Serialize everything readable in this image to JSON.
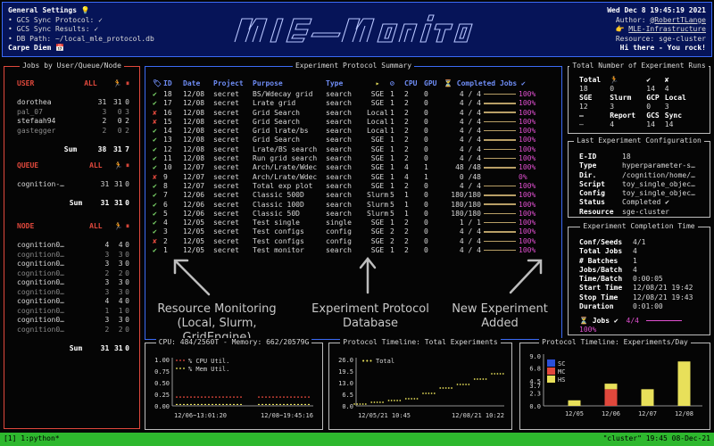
{
  "header": {
    "title": "General Settings",
    "title_icon": "lightbulb-icon",
    "lines": [
      "• GCS Sync Protocol: ✓",
      "• GCS Sync Results: ✓",
      "• DB Path: ~/local_mle_protocol.db"
    ],
    "motto": "Carpe Diem",
    "motto_icon": "calendar-icon",
    "date": "Wed Dec 8 19:45:19 2021",
    "author_label": "Author:",
    "author": "@RobertTLange",
    "infra": "MLE-Infrastructure",
    "resource": "Resource: sge-cluster",
    "greeting": "Hi there - You rock!",
    "logo_text": "mle-monitor"
  },
  "jobs_panel": {
    "title": "Jobs by User/Queue/Node",
    "user_section": {
      "header": [
        "USER",
        "ALL",
        "🏃",
        "⏸"
      ],
      "rows": [
        [
          "dorothea",
          "31",
          "31",
          "0"
        ],
        [
          "pal_07",
          "3",
          "0",
          "3"
        ],
        [
          "stefaah94",
          "2",
          "0",
          "2"
        ],
        [
          "gastegger",
          "2",
          "0",
          "2"
        ]
      ],
      "sum": [
        "Sum",
        "38",
        "31",
        "7"
      ]
    },
    "queue_section": {
      "header": [
        "QUEUE",
        "ALL",
        "🏃",
        "⏸"
      ],
      "rows": [
        [
          "cognition-…",
          "31",
          "31",
          "0"
        ]
      ],
      "sum": [
        "Sum",
        "31",
        "31",
        "0"
      ]
    },
    "node_section": {
      "header": [
        "NODE",
        "ALL",
        "🏃",
        "⏸"
      ],
      "rows": [
        [
          "cognition0…",
          "4",
          "4",
          "0"
        ],
        [
          "cognition0…",
          "3",
          "3",
          "0"
        ],
        [
          "cognition0…",
          "3",
          "3",
          "0"
        ],
        [
          "cognition0…",
          "2",
          "2",
          "0"
        ],
        [
          "cognition0…",
          "3",
          "3",
          "0"
        ],
        [
          "cognition0…",
          "3",
          "3",
          "0"
        ],
        [
          "cognition0…",
          "4",
          "4",
          "0"
        ],
        [
          "cognition0…",
          "1",
          "1",
          "0"
        ],
        [
          "cognition0…",
          "3",
          "3",
          "0"
        ],
        [
          "cognition0…",
          "2",
          "2",
          "0"
        ]
      ],
      "sum": [
        "Sum",
        "31",
        "31",
        "0"
      ]
    }
  },
  "protocol": {
    "title": "Experiment Protocol Summary",
    "columns": [
      "",
      "ID",
      "Date",
      "Project",
      "Purpose",
      "Type",
      "▸",
      "⊘",
      "CPU",
      "GPU",
      "⏳ Completed Jobs ✔"
    ],
    "rows": [
      {
        "status": "✔",
        "id": "18",
        "date": "12/08",
        "project": "secret",
        "purpose": "BS/Wdecay grid",
        "type": "search",
        "res": "SGE",
        "a": "1",
        "cpu": "2",
        "gpu": "0",
        "done": "4 / 4",
        "pct": "100%",
        "frac": 1.0
      },
      {
        "status": "✔",
        "id": "17",
        "date": "12/08",
        "project": "secret",
        "purpose": "Lrate grid",
        "type": "search",
        "res": "SGE",
        "a": "1",
        "cpu": "2",
        "gpu": "0",
        "done": "4 / 4",
        "pct": "100%",
        "frac": 1.0
      },
      {
        "status": "✘",
        "id": "16",
        "date": "12/08",
        "project": "secret",
        "purpose": "Grid Search",
        "type": "search",
        "res": "Local",
        "a": "1",
        "cpu": "2",
        "gpu": "0",
        "done": "4 / 4",
        "pct": "100%",
        "frac": 1.0
      },
      {
        "status": "✘",
        "id": "15",
        "date": "12/08",
        "project": "secret",
        "purpose": "Grid Search",
        "type": "search",
        "res": "Local",
        "a": "1",
        "cpu": "2",
        "gpu": "0",
        "done": "4 / 4",
        "pct": "100%",
        "frac": 1.0
      },
      {
        "status": "✔",
        "id": "14",
        "date": "12/08",
        "project": "secret",
        "purpose": "Grid lrate/bs",
        "type": "search",
        "res": "Local",
        "a": "1",
        "cpu": "2",
        "gpu": "0",
        "done": "4 / 4",
        "pct": "100%",
        "frac": 1.0
      },
      {
        "status": "✔",
        "id": "13",
        "date": "12/08",
        "project": "secret",
        "purpose": "Grid Search",
        "type": "search",
        "res": "SGE",
        "a": "1",
        "cpu": "2",
        "gpu": "0",
        "done": "4 / 4",
        "pct": "100%",
        "frac": 1.0
      },
      {
        "status": "✔",
        "id": "12",
        "date": "12/08",
        "project": "secret",
        "purpose": "Lrate/BS search",
        "type": "search",
        "res": "SGE",
        "a": "1",
        "cpu": "2",
        "gpu": "0",
        "done": "4 / 4",
        "pct": "100%",
        "frac": 1.0
      },
      {
        "status": "✔",
        "id": "11",
        "date": "12/08",
        "project": "secret",
        "purpose": "Run grid search",
        "type": "search",
        "res": "SGE",
        "a": "1",
        "cpu": "2",
        "gpu": "0",
        "done": "4 / 4",
        "pct": "100%",
        "frac": 1.0
      },
      {
        "status": "✔",
        "id": "10",
        "date": "12/07",
        "project": "secret",
        "purpose": "Arch/Lrate/Wdec",
        "type": "search",
        "res": "SGE",
        "a": "1",
        "cpu": "4",
        "gpu": "1",
        "done": "48 /48",
        "pct": "100%",
        "frac": 1.0
      },
      {
        "status": "✘",
        "id": "9",
        "date": "12/07",
        "project": "secret",
        "purpose": "Arch/Lrate/Wdec",
        "type": "search",
        "res": "SGE",
        "a": "1",
        "cpu": "4",
        "gpu": "1",
        "done": "0 /48",
        "pct": "0%",
        "frac": 0.0
      },
      {
        "status": "✔",
        "id": "8",
        "date": "12/07",
        "project": "secret",
        "purpose": "Total exp plot",
        "type": "search",
        "res": "SGE",
        "a": "1",
        "cpu": "2",
        "gpu": "0",
        "done": "4 / 4",
        "pct": "100%",
        "frac": 1.0
      },
      {
        "status": "✔",
        "id": "7",
        "date": "12/06",
        "project": "secret",
        "purpose": "Classic 500D",
        "type": "search",
        "res": "Slurm",
        "a": "5",
        "cpu": "1",
        "gpu": "0",
        "done": "180/180",
        "pct": "100%",
        "frac": 1.0
      },
      {
        "status": "✔",
        "id": "6",
        "date": "12/06",
        "project": "secret",
        "purpose": "Classic 100D",
        "type": "search",
        "res": "Slurm",
        "a": "5",
        "cpu": "1",
        "gpu": "0",
        "done": "180/180",
        "pct": "100%",
        "frac": 1.0
      },
      {
        "status": "✔",
        "id": "5",
        "date": "12/06",
        "project": "secret",
        "purpose": "Classic 50D",
        "type": "search",
        "res": "Slurm",
        "a": "5",
        "cpu": "1",
        "gpu": "0",
        "done": "180/180",
        "pct": "100%",
        "frac": 1.0
      },
      {
        "status": "✔",
        "id": "4",
        "date": "12/05",
        "project": "secret",
        "purpose": "Test single",
        "type": "single",
        "res": "SGE",
        "a": "1",
        "cpu": "2",
        "gpu": "0",
        "done": "1 / 1",
        "pct": "100%",
        "frac": 1.0
      },
      {
        "status": "✔",
        "id": "3",
        "date": "12/05",
        "project": "secret",
        "purpose": "Test configs",
        "type": "config",
        "res": "SGE",
        "a": "2",
        "cpu": "2",
        "gpu": "0",
        "done": "4 / 4",
        "pct": "100%",
        "frac": 1.0
      },
      {
        "status": "✘",
        "id": "2",
        "date": "12/05",
        "project": "secret",
        "purpose": "Test configs",
        "type": "config",
        "res": "SGE",
        "a": "2",
        "cpu": "2",
        "gpu": "0",
        "done": "4 / 4",
        "pct": "100%",
        "frac": 1.0
      },
      {
        "status": "✔",
        "id": "1",
        "date": "12/05",
        "project": "secret",
        "purpose": "Test monitor",
        "type": "search",
        "res": "SGE",
        "a": "1",
        "cpu": "2",
        "gpu": "0",
        "done": "4 / 4",
        "pct": "100%",
        "frac": 1.0
      }
    ]
  },
  "annotations": {
    "resource": "Resource Monitoring\n(Local, Slurm, GridEngine)",
    "database": "Experiment Protocol\nDatabase",
    "new_experiment": "New Experiment\nAdded"
  },
  "total_runs": {
    "title": "Total Number of Experiment Runs",
    "row1": [
      "Total",
      "🏃",
      "✔",
      "✘"
    ],
    "row2": [
      "18",
      "0",
      "14",
      "4"
    ],
    "row3": [
      "SGE",
      "Slurm",
      "GCP",
      "Local"
    ],
    "row4": [
      "12",
      "3",
      "0",
      "3"
    ],
    "row5": [
      "—",
      "Report",
      "GCS",
      "Sync"
    ],
    "row6": [
      "—",
      "4",
      "14",
      "14"
    ]
  },
  "last_config": {
    "title": "Last Experiment Configuration",
    "rows": [
      [
        "E-ID",
        "18"
      ],
      [
        "Type",
        "hyperparameter-s…"
      ],
      [
        "Dir.",
        "/cognition/home/…"
      ],
      [
        "Script",
        "toy_single_objec…"
      ],
      [
        "Config",
        "toy_single_objec…"
      ],
      [
        "Status",
        "Completed ✔"
      ],
      [
        "Resource",
        "sge-cluster"
      ]
    ]
  },
  "completion_time": {
    "title": "Experiment Completion Time",
    "rows": [
      [
        "Conf/Seeds",
        "4/1"
      ],
      [
        "Total Jobs",
        "4"
      ],
      [
        "# Batches",
        "1"
      ],
      [
        "Jobs/Batch",
        "4"
      ],
      [
        "Time/Batch",
        "0:00:05"
      ],
      [
        "Start Time",
        "12/08/21 19:42"
      ],
      [
        "Stop Time",
        "12/08/21 19:43"
      ],
      [
        "Duration",
        "0:01:00"
      ]
    ],
    "jobs_label": "⏳ Jobs ✔",
    "jobs_value": "4/4",
    "jobs_pct": "100%",
    "jobs_frac": 1.0
  },
  "cpu_panel": {
    "title": "CPU: 484/2560T - Memory: 662/20579G",
    "legend_cpu": "% CPU Util.",
    "legend_mem": "% Mem Util.",
    "y_ticks": [
      "1.00",
      "0.75",
      "0.50",
      "0.25",
      "0.00"
    ],
    "x_ticks": [
      "12/06~13:01:20",
      "12/08~19:45:16"
    ],
    "cpu_color": "#e0483c",
    "mem_color": "#e8e05a"
  },
  "timeline_total": {
    "title": "Protocol Timeline: Total Experiments",
    "legend": "Total",
    "y_ticks": [
      "26.0",
      "19.5",
      "13.0",
      "6.5",
      "0.0"
    ],
    "x_ticks": [
      "12/05/21 10:45",
      "12/08/21 10:22"
    ]
  },
  "timeline_day": {
    "title": "Protocol Timeline: Experiments/Day",
    "y_ticks": [
      "9.0",
      "6.8",
      "4.5",
      "3.7",
      "2.3",
      "0.0"
    ],
    "x_ticks": [
      "12/05",
      "12/06",
      "12/07",
      "12/08"
    ],
    "legend": [
      {
        "name": "SC",
        "color": "#2b4fd8"
      },
      {
        "name": "MC",
        "color": "#e0483c"
      },
      {
        "name": "HS",
        "color": "#e8e05a"
      }
    ]
  },
  "chart_data": [
    {
      "type": "line",
      "title": "CPU: 484/2560T - Memory: 662/20579G",
      "series": [
        {
          "name": "% CPU Util.",
          "values": [
            0.19,
            0.19
          ]
        },
        {
          "name": "% Mem Util.",
          "values": [
            0.03,
            0.03
          ]
        }
      ],
      "x": [
        "12/06~13:01:20",
        "12/08~19:45:16"
      ],
      "ylim": [
        0,
        1
      ]
    },
    {
      "type": "scatter",
      "title": "Protocol Timeline: Total Experiments",
      "series": [
        {
          "name": "Total",
          "values": [
            1,
            2,
            3,
            4,
            7,
            10,
            12,
            15,
            18
          ]
        }
      ],
      "x": [
        "12/05/21 10:45",
        "12/08/21 10:22"
      ],
      "ylim": [
        0,
        26
      ]
    },
    {
      "type": "bar",
      "title": "Protocol Timeline: Experiments/Day",
      "categories": [
        "12/05",
        "12/06",
        "12/07",
        "12/08"
      ],
      "series": [
        {
          "name": "SC",
          "values": [
            0,
            0,
            0,
            0
          ]
        },
        {
          "name": "MC",
          "values": [
            0,
            3,
            0,
            0
          ]
        },
        {
          "name": "HS",
          "values": [
            1,
            1,
            3,
            8
          ]
        }
      ],
      "ylim": [
        0,
        9
      ]
    }
  ],
  "statusbar": {
    "left": "[1] 1:python*",
    "right": "\"cluster\" 19:45 08-Dec-21"
  }
}
